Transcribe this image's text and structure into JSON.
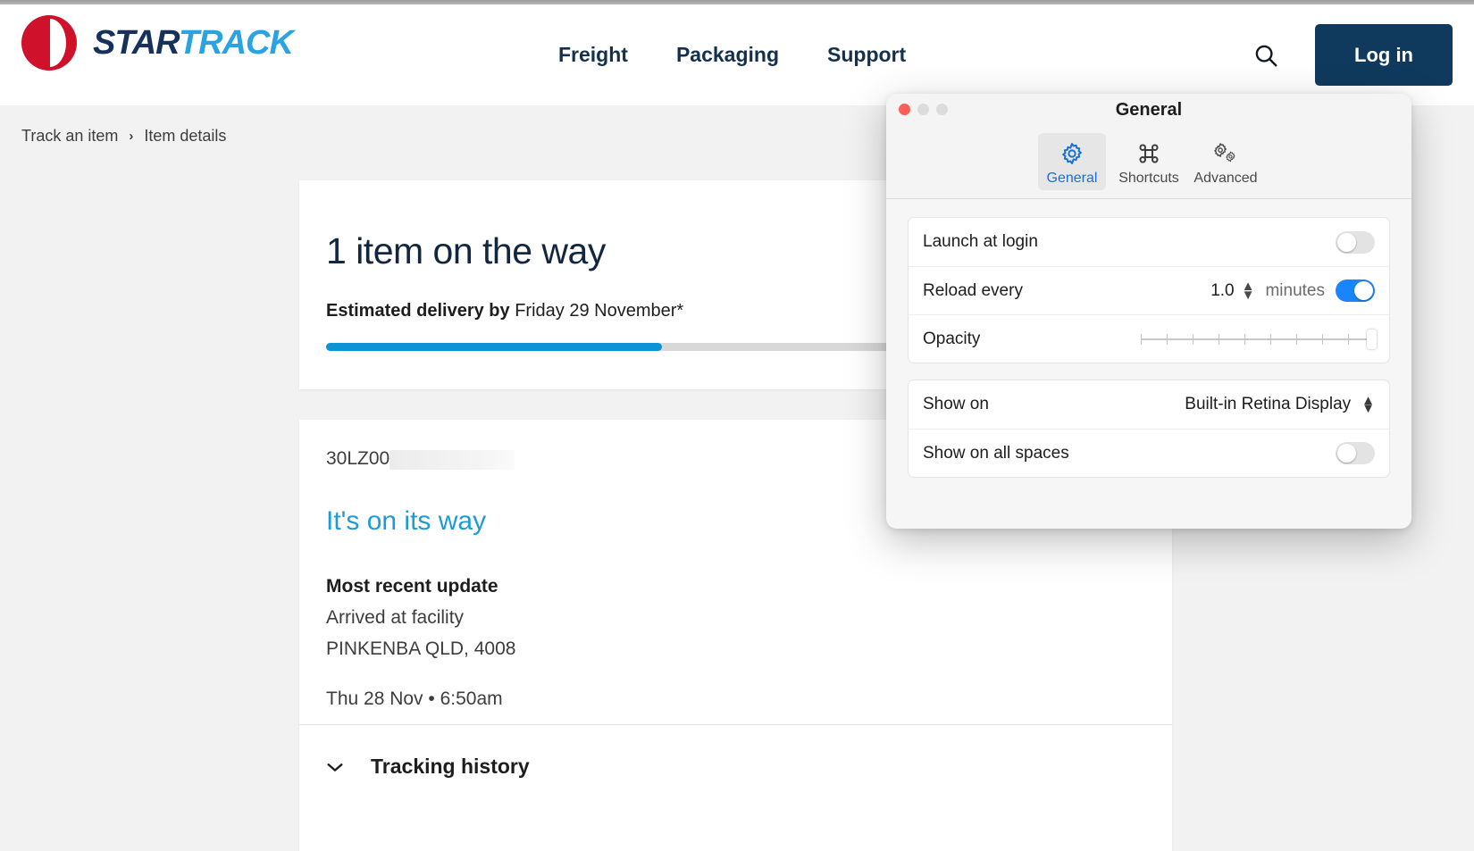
{
  "site": {
    "logo": {
      "star": "STAR",
      "track": "TRACK",
      "alt": "startrack-logo"
    },
    "nav": [
      {
        "label": "Freight"
      },
      {
        "label": "Packaging"
      },
      {
        "label": "Support"
      }
    ],
    "search_icon": "search-icon",
    "login_label": "Log in"
  },
  "breadcrumb": {
    "first": "Track an item",
    "separator": "›",
    "current": "Item details"
  },
  "summary": {
    "title": "1 item on the way",
    "eta_label": "Estimated delivery by",
    "eta_value": "Friday 29 November*",
    "progress_percent": 41
  },
  "details": {
    "tracking_id": "30LZ00",
    "status": "It's on its way",
    "update_heading": "Most recent update",
    "update_event": "Arrived at facility",
    "update_location": "PINKENBA QLD, 4008",
    "update_time": "Thu 28 Nov • 6:50am",
    "history_label": "Tracking history",
    "history_chevron": "chevron-down-icon"
  },
  "dialog": {
    "title": "General",
    "tabs": [
      {
        "label": "General",
        "icon": "gear-icon",
        "active": true
      },
      {
        "label": "Shortcuts",
        "icon": "command-key-icon",
        "active": false
      },
      {
        "label": "Advanced",
        "icon": "double-gear-icon",
        "active": false
      }
    ],
    "rows": {
      "launch_at_login": {
        "label": "Launch at login",
        "toggle": "off"
      },
      "reload_every": {
        "label": "Reload every",
        "value": "1.0",
        "unit": "minutes",
        "toggle": "on"
      },
      "opacity": {
        "label": "Opacity",
        "value_percent": 100,
        "tick_count": 10
      },
      "show_on": {
        "label": "Show on",
        "selected": "Built-in Retina Display"
      },
      "show_on_all_spaces": {
        "label": "Show on all spaces",
        "toggle": "off"
      }
    }
  },
  "colors": {
    "brand_navy": "#103a5d",
    "brand_red": "#d0112b",
    "brand_blue": "#29a3e3",
    "progress_blue": "#0b93d5",
    "status_blue": "#1d9bd8",
    "toggle_on": "#1a84fb",
    "page_bg": "#f2f2f2"
  }
}
